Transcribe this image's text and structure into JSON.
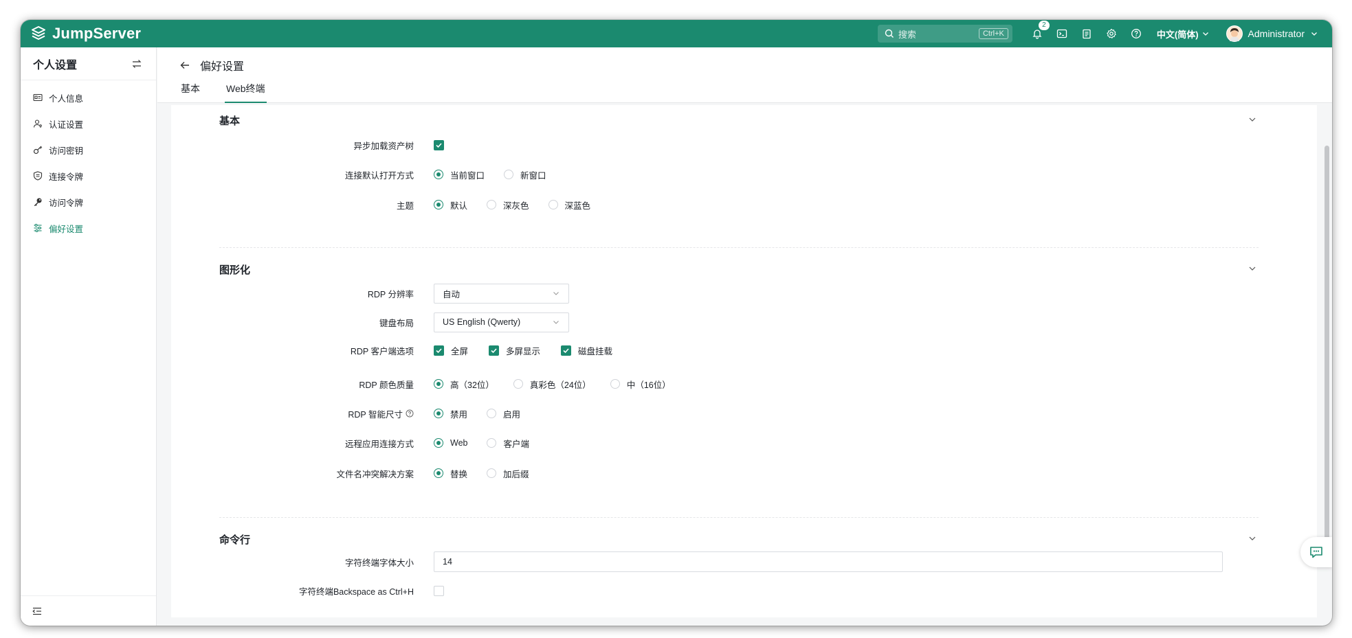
{
  "app": {
    "name": "JumpServer",
    "brand_color": "#1b8a6f"
  },
  "header": {
    "search_placeholder": "搜索",
    "search_shortcut": "Ctrl+K",
    "notification_count": "2",
    "language": "中文(简体)",
    "user_name": "Administrator"
  },
  "sidebar": {
    "title": "个人设置",
    "items": [
      {
        "label": "个人信息",
        "icon": "id-card-icon"
      },
      {
        "label": "认证设置",
        "icon": "user-key-icon"
      },
      {
        "label": "访问密钥",
        "icon": "key-outline-icon"
      },
      {
        "label": "连接令牌",
        "icon": "shield-icon"
      },
      {
        "label": "访问令牌",
        "icon": "key-solid-icon"
      },
      {
        "label": "偏好设置",
        "icon": "sliders-icon",
        "active": true
      }
    ]
  },
  "page": {
    "title": "偏好设置",
    "tabs": [
      {
        "label": "基本",
        "active": false
      },
      {
        "label": "Web终端",
        "active": true
      }
    ]
  },
  "sections": {
    "basic": {
      "title": "基本",
      "async_tree": {
        "label": "异步加载资产树",
        "checked": true
      },
      "open_mode": {
        "label": "连接默认打开方式",
        "options": [
          "当前窗口",
          "新窗口"
        ],
        "selected": "当前窗口"
      },
      "theme": {
        "label": "主题",
        "options": [
          "默认",
          "深灰色",
          "深蓝色"
        ],
        "selected": "默认"
      }
    },
    "graphical": {
      "title": "图形化",
      "rdp_resolution": {
        "label": "RDP 分辨率",
        "value": "自动"
      },
      "keyboard_layout": {
        "label": "键盘布局",
        "value": "US English (Qwerty)"
      },
      "rdp_client_options": {
        "label": "RDP 客户端选项",
        "options": [
          "全屏",
          "多屏显示",
          "磁盘挂载"
        ],
        "checked": [
          true,
          true,
          true
        ]
      },
      "rdp_color_quality": {
        "label": "RDP 颜色质量",
        "options": [
          "高（32位）",
          "真彩色（24位）",
          "中（16位）"
        ],
        "selected": "高（32位）"
      },
      "rdp_smart_size": {
        "label": "RDP 智能尺寸",
        "options": [
          "禁用",
          "启用"
        ],
        "selected": "禁用"
      },
      "remote_app_mode": {
        "label": "远程应用连接方式",
        "options": [
          "Web",
          "客户端"
        ],
        "selected": "Web"
      },
      "file_conflict": {
        "label": "文件名冲突解决方案",
        "options": [
          "替换",
          "加后缀"
        ],
        "selected": "替换"
      }
    },
    "command_line": {
      "title": "命令行",
      "font_size": {
        "label": "字符终端字体大小",
        "value": "14"
      },
      "backspace": {
        "label": "字符终端Backspace as Ctrl+H",
        "checked": false
      }
    }
  }
}
